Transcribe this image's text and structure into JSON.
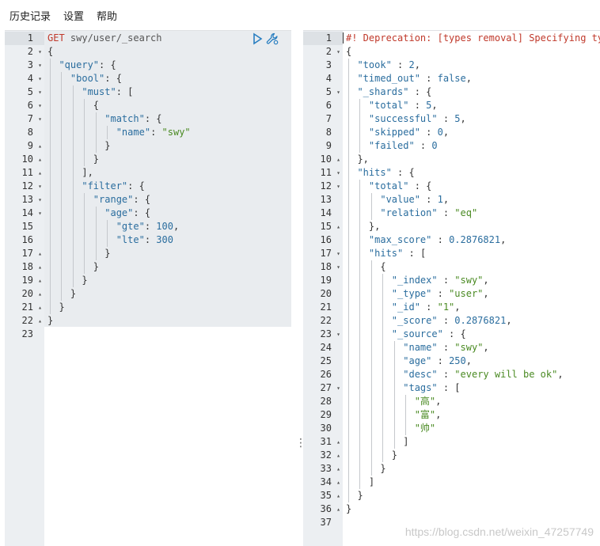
{
  "menu": {
    "items": [
      "历史记录",
      "设置",
      "帮助"
    ]
  },
  "request": {
    "lines": [
      [
        [
          "tk-method",
          "GET "
        ],
        [
          "tk-url",
          "swy/user/_search"
        ]
      ],
      [
        [
          "tk-punct",
          "{"
        ]
      ],
      [
        [
          "tk-punct",
          "  "
        ],
        [
          "tk-key",
          "\"query\""
        ],
        [
          "tk-punct",
          ": {"
        ]
      ],
      [
        [
          "tk-punct",
          "    "
        ],
        [
          "tk-key",
          "\"bool\""
        ],
        [
          "tk-punct",
          ": {"
        ]
      ],
      [
        [
          "tk-punct",
          "      "
        ],
        [
          "tk-key",
          "\"must\""
        ],
        [
          "tk-punct",
          ": ["
        ]
      ],
      [
        [
          "tk-punct",
          "        {"
        ]
      ],
      [
        [
          "tk-punct",
          "          "
        ],
        [
          "tk-key",
          "\"match\""
        ],
        [
          "tk-punct",
          ": {"
        ]
      ],
      [
        [
          "tk-punct",
          "            "
        ],
        [
          "tk-key",
          "\"name\""
        ],
        [
          "tk-punct",
          ": "
        ],
        [
          "tk-str",
          "\"swy\""
        ]
      ],
      [
        [
          "tk-punct",
          "          }"
        ]
      ],
      [
        [
          "tk-punct",
          "        }"
        ]
      ],
      [
        [
          "tk-punct",
          "      ],"
        ]
      ],
      [
        [
          "tk-punct",
          "      "
        ],
        [
          "tk-key",
          "\"filter\""
        ],
        [
          "tk-punct",
          ": {"
        ]
      ],
      [
        [
          "tk-punct",
          "        "
        ],
        [
          "tk-key",
          "\"range\""
        ],
        [
          "tk-punct",
          ": {"
        ]
      ],
      [
        [
          "tk-punct",
          "          "
        ],
        [
          "tk-key",
          "\"age\""
        ],
        [
          "tk-punct",
          ": {"
        ]
      ],
      [
        [
          "tk-punct",
          "            "
        ],
        [
          "tk-key",
          "\"gte\""
        ],
        [
          "tk-punct",
          ": "
        ],
        [
          "tk-num",
          "100"
        ],
        [
          "tk-punct",
          ","
        ]
      ],
      [
        [
          "tk-punct",
          "            "
        ],
        [
          "tk-key",
          "\"lte\""
        ],
        [
          "tk-punct",
          ": "
        ],
        [
          "tk-num",
          "300"
        ]
      ],
      [
        [
          "tk-punct",
          "          }"
        ]
      ],
      [
        [
          "tk-punct",
          "        }"
        ]
      ],
      [
        [
          "tk-punct",
          "      }"
        ]
      ],
      [
        [
          "tk-punct",
          "    }"
        ]
      ],
      [
        [
          "tk-punct",
          "  }"
        ]
      ],
      [
        [
          "tk-punct",
          "}"
        ]
      ],
      []
    ],
    "folds": [
      "",
      "▾",
      "▾",
      "▾",
      "▾",
      "▾",
      "▾",
      "",
      "▴",
      "▴",
      "▴",
      "▾",
      "▾",
      "▾",
      "",
      "",
      "▴",
      "▴",
      "▴",
      "▴",
      "▴",
      "▴",
      ""
    ]
  },
  "response": {
    "lines": [
      [
        [
          "tk-comment",
          "#! Deprecation: [types removal] Specifying types in search requests is deprecated."
        ]
      ],
      [
        [
          "tk-punct",
          "{"
        ]
      ],
      [
        [
          "tk-punct",
          "  "
        ],
        [
          "tk-key",
          "\"took\""
        ],
        [
          "tk-punct",
          " : "
        ],
        [
          "tk-num",
          "2"
        ],
        [
          "tk-punct",
          ","
        ]
      ],
      [
        [
          "tk-punct",
          "  "
        ],
        [
          "tk-key",
          "\"timed_out\""
        ],
        [
          "tk-punct",
          " : "
        ],
        [
          "tk-kw",
          "false"
        ],
        [
          "tk-punct",
          ","
        ]
      ],
      [
        [
          "tk-punct",
          "  "
        ],
        [
          "tk-key",
          "\"_shards\""
        ],
        [
          "tk-punct",
          " : {"
        ]
      ],
      [
        [
          "tk-punct",
          "    "
        ],
        [
          "tk-key",
          "\"total\""
        ],
        [
          "tk-punct",
          " : "
        ],
        [
          "tk-num",
          "5"
        ],
        [
          "tk-punct",
          ","
        ]
      ],
      [
        [
          "tk-punct",
          "    "
        ],
        [
          "tk-key",
          "\"successful\""
        ],
        [
          "tk-punct",
          " : "
        ],
        [
          "tk-num",
          "5"
        ],
        [
          "tk-punct",
          ","
        ]
      ],
      [
        [
          "tk-punct",
          "    "
        ],
        [
          "tk-key",
          "\"skipped\""
        ],
        [
          "tk-punct",
          " : "
        ],
        [
          "tk-num",
          "0"
        ],
        [
          "tk-punct",
          ","
        ]
      ],
      [
        [
          "tk-punct",
          "    "
        ],
        [
          "tk-key",
          "\"failed\""
        ],
        [
          "tk-punct",
          " : "
        ],
        [
          "tk-num",
          "0"
        ]
      ],
      [
        [
          "tk-punct",
          "  },"
        ]
      ],
      [
        [
          "tk-punct",
          "  "
        ],
        [
          "tk-key",
          "\"hits\""
        ],
        [
          "tk-punct",
          " : {"
        ]
      ],
      [
        [
          "tk-punct",
          "    "
        ],
        [
          "tk-key",
          "\"total\""
        ],
        [
          "tk-punct",
          " : {"
        ]
      ],
      [
        [
          "tk-punct",
          "      "
        ],
        [
          "tk-key",
          "\"value\""
        ],
        [
          "tk-punct",
          " : "
        ],
        [
          "tk-num",
          "1"
        ],
        [
          "tk-punct",
          ","
        ]
      ],
      [
        [
          "tk-punct",
          "      "
        ],
        [
          "tk-key",
          "\"relation\""
        ],
        [
          "tk-punct",
          " : "
        ],
        [
          "tk-str",
          "\"eq\""
        ]
      ],
      [
        [
          "tk-punct",
          "    },"
        ]
      ],
      [
        [
          "tk-punct",
          "    "
        ],
        [
          "tk-key",
          "\"max_score\""
        ],
        [
          "tk-punct",
          " : "
        ],
        [
          "tk-num",
          "0.2876821"
        ],
        [
          "tk-punct",
          ","
        ]
      ],
      [
        [
          "tk-punct",
          "    "
        ],
        [
          "tk-key",
          "\"hits\""
        ],
        [
          "tk-punct",
          " : ["
        ]
      ],
      [
        [
          "tk-punct",
          "      {"
        ]
      ],
      [
        [
          "tk-punct",
          "        "
        ],
        [
          "tk-key",
          "\"_index\""
        ],
        [
          "tk-punct",
          " : "
        ],
        [
          "tk-str",
          "\"swy\""
        ],
        [
          "tk-punct",
          ","
        ]
      ],
      [
        [
          "tk-punct",
          "        "
        ],
        [
          "tk-key",
          "\"_type\""
        ],
        [
          "tk-punct",
          " : "
        ],
        [
          "tk-str",
          "\"user\""
        ],
        [
          "tk-punct",
          ","
        ]
      ],
      [
        [
          "tk-punct",
          "        "
        ],
        [
          "tk-key",
          "\"_id\""
        ],
        [
          "tk-punct",
          " : "
        ],
        [
          "tk-str",
          "\"1\""
        ],
        [
          "tk-punct",
          ","
        ]
      ],
      [
        [
          "tk-punct",
          "        "
        ],
        [
          "tk-key",
          "\"_score\""
        ],
        [
          "tk-punct",
          " : "
        ],
        [
          "tk-num",
          "0.2876821"
        ],
        [
          "tk-punct",
          ","
        ]
      ],
      [
        [
          "tk-punct",
          "        "
        ],
        [
          "tk-key",
          "\"_source\""
        ],
        [
          "tk-punct",
          " : {"
        ]
      ],
      [
        [
          "tk-punct",
          "          "
        ],
        [
          "tk-key",
          "\"name\""
        ],
        [
          "tk-punct",
          " : "
        ],
        [
          "tk-str",
          "\"swy\""
        ],
        [
          "tk-punct",
          ","
        ]
      ],
      [
        [
          "tk-punct",
          "          "
        ],
        [
          "tk-key",
          "\"age\""
        ],
        [
          "tk-punct",
          " : "
        ],
        [
          "tk-num",
          "250"
        ],
        [
          "tk-punct",
          ","
        ]
      ],
      [
        [
          "tk-punct",
          "          "
        ],
        [
          "tk-key",
          "\"desc\""
        ],
        [
          "tk-punct",
          " : "
        ],
        [
          "tk-str",
          "\"every will be ok\""
        ],
        [
          "tk-punct",
          ","
        ]
      ],
      [
        [
          "tk-punct",
          "          "
        ],
        [
          "tk-key",
          "\"tags\""
        ],
        [
          "tk-punct",
          " : ["
        ]
      ],
      [
        [
          "tk-punct",
          "            "
        ],
        [
          "tk-str",
          "\"高\""
        ],
        [
          "tk-punct",
          ","
        ]
      ],
      [
        [
          "tk-punct",
          "            "
        ],
        [
          "tk-str",
          "\"富\""
        ],
        [
          "tk-punct",
          ","
        ]
      ],
      [
        [
          "tk-punct",
          "            "
        ],
        [
          "tk-str",
          "\"帅\""
        ]
      ],
      [
        [
          "tk-punct",
          "          ]"
        ]
      ],
      [
        [
          "tk-punct",
          "        }"
        ]
      ],
      [
        [
          "tk-punct",
          "      }"
        ]
      ],
      [
        [
          "tk-punct",
          "    ]"
        ]
      ],
      [
        [
          "tk-punct",
          "  }"
        ]
      ],
      [
        [
          "tk-punct",
          "}"
        ]
      ],
      []
    ],
    "folds": [
      "",
      "▾",
      "",
      "",
      "▾",
      "",
      "",
      "",
      "",
      "▴",
      "▾",
      "▾",
      "",
      "",
      "▴",
      "",
      "▾",
      "▾",
      "",
      "",
      "",
      "",
      "▾",
      "",
      "",
      "",
      "▾",
      "",
      "",
      "",
      "▴",
      "▴",
      "▴",
      "▴",
      "▴",
      "▴",
      ""
    ]
  },
  "icons": {
    "run": "play-icon",
    "settings": "wrench-icon"
  },
  "watermark": "https://blog.csdn.net/weixin_47257749",
  "colors": {
    "gutter": "#eceff2",
    "selection": "#e9ecef",
    "key": "#2a6d9e",
    "string": "#4a8a22",
    "method": "#c0392b"
  }
}
